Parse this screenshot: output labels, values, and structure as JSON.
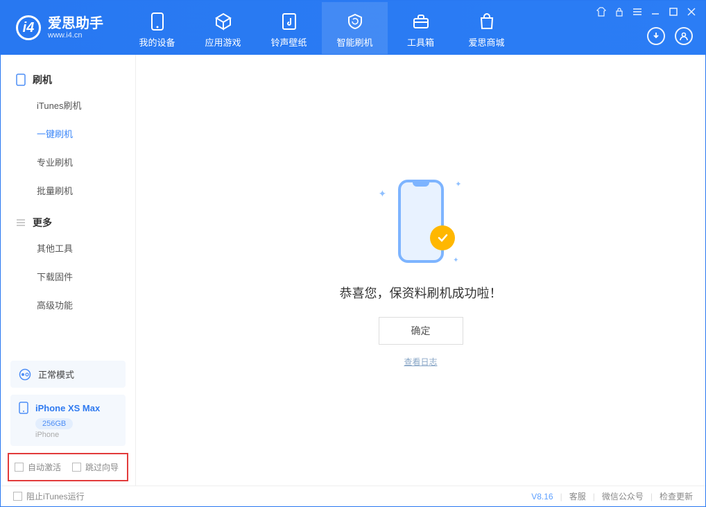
{
  "app": {
    "name_cn": "爱思助手",
    "name_en": "www.i4.cn"
  },
  "nav": {
    "items": [
      {
        "label": "我的设备"
      },
      {
        "label": "应用游戏"
      },
      {
        "label": "铃声壁纸"
      },
      {
        "label": "智能刷机"
      },
      {
        "label": "工具箱"
      },
      {
        "label": "爱思商城"
      }
    ],
    "active_index": 3
  },
  "sidebar": {
    "sections": [
      {
        "title": "刷机",
        "items": [
          "iTunes刷机",
          "一键刷机",
          "专业刷机",
          "批量刷机"
        ],
        "active_index": 1
      },
      {
        "title": "更多",
        "items": [
          "其他工具",
          "下载固件",
          "高级功能"
        ],
        "active_index": -1
      }
    ],
    "mode_label": "正常模式",
    "device": {
      "name": "iPhone XS Max",
      "storage": "256GB",
      "type": "iPhone"
    },
    "checkboxes": {
      "auto_activate": "自动激活",
      "skip_guide": "跳过向导"
    }
  },
  "main": {
    "success_text": "恭喜您，保资料刷机成功啦！",
    "ok_label": "确定",
    "log_label": "查看日志"
  },
  "footer": {
    "block_itunes": "阻止iTunes运行",
    "version": "V8.16",
    "links": [
      "客服",
      "微信公众号",
      "检查更新"
    ]
  },
  "colors": {
    "primary": "#2b7df5",
    "accent": "#ffb700",
    "highlight_border": "#e23b3b"
  }
}
